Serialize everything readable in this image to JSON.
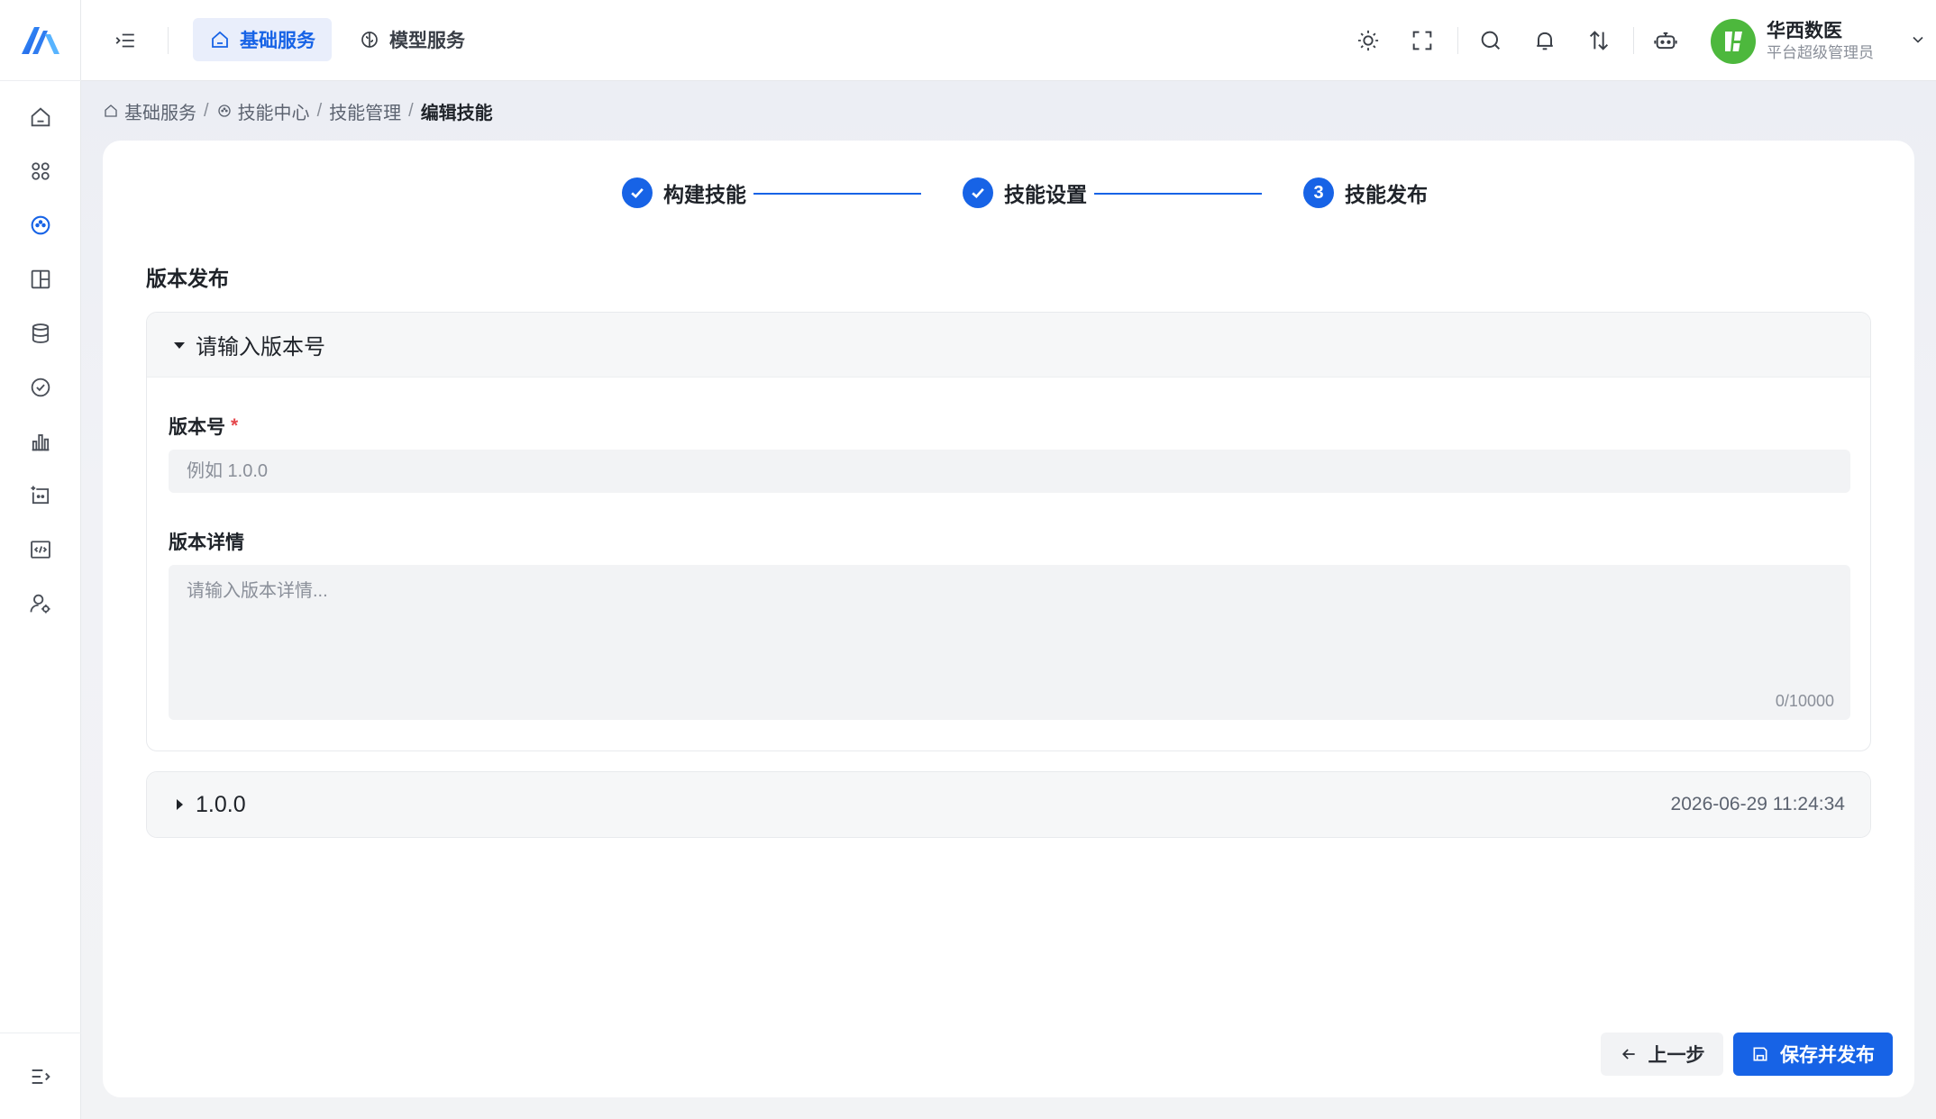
{
  "header": {
    "tabs": [
      {
        "label": "基础服务",
        "icon": "home-icon",
        "active": true
      },
      {
        "label": "模型服务",
        "icon": "brain-icon",
        "active": false
      }
    ],
    "icons": [
      "theme-icon",
      "fullscreen-icon",
      "search-icon",
      "bell-icon",
      "transfer-icon",
      "robot-icon"
    ],
    "user": {
      "name": "华西数医",
      "role": "平台超级管理员"
    }
  },
  "sidebar": {
    "items": [
      {
        "icon": "home-icon",
        "active": false
      },
      {
        "icon": "apps-icon",
        "active": false
      },
      {
        "icon": "skill-icon",
        "active": true
      },
      {
        "icon": "layout-icon",
        "active": false
      },
      {
        "icon": "database-icon",
        "active": false
      },
      {
        "icon": "check-circle-icon",
        "active": false
      },
      {
        "icon": "bar-chart-icon",
        "active": false
      },
      {
        "icon": "agent-icon",
        "active": false
      },
      {
        "icon": "code-icon",
        "active": false
      },
      {
        "icon": "user-settings-icon",
        "active": false
      }
    ],
    "bottom_icon": "collapse-icon"
  },
  "breadcrumb": {
    "items": [
      {
        "label": "基础服务"
      },
      {
        "label": "技能中心"
      },
      {
        "label": "技能管理"
      },
      {
        "label": "编辑技能"
      }
    ],
    "separator": "/"
  },
  "steps": [
    {
      "label": "构建技能",
      "status": "done"
    },
    {
      "label": "技能设置",
      "status": "done"
    },
    {
      "label": "技能发布",
      "status": "current",
      "number": "3"
    }
  ],
  "section_title": "版本发布",
  "new_version_panel": {
    "title": "请输入版本号",
    "version_label": "版本号",
    "required_mark": "*",
    "version_placeholder": "例如 1.0.0",
    "detail_label": "版本详情",
    "detail_placeholder": "请输入版本详情...",
    "counter": "0/10000"
  },
  "versions": [
    {
      "version": "1.0.0",
      "time": "2026-06-29 11:24:34"
    }
  ],
  "buttons": {
    "prev": "上一步",
    "save": "保存并发布"
  },
  "colors": {
    "primary": "#1763e6",
    "avatar": "#4db83d",
    "required": "#e5484d"
  }
}
